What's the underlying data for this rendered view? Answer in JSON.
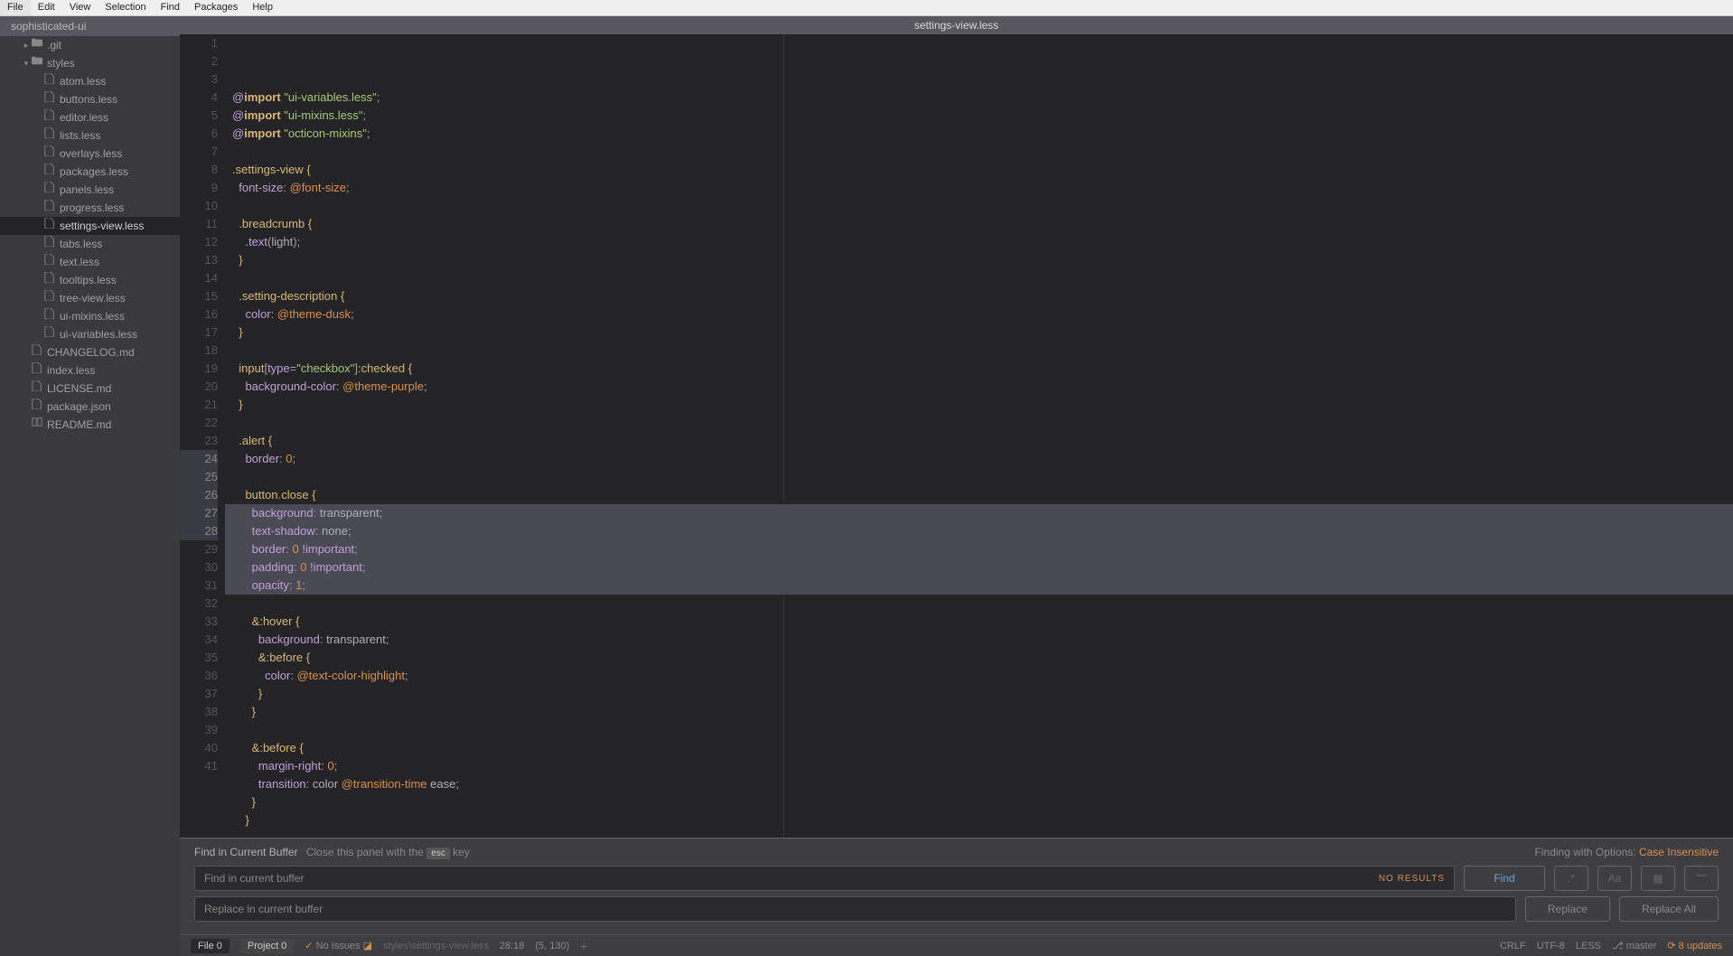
{
  "menubar": [
    "File",
    "Edit",
    "View",
    "Selection",
    "Find",
    "Packages",
    "Help"
  ],
  "project": {
    "title": "sophisticated-ui"
  },
  "tree": {
    "folders": [
      {
        "label": ".git",
        "chev": "▸",
        "depth": 1,
        "kind": "folder"
      },
      {
        "label": "styles",
        "chev": "▾",
        "depth": 1,
        "kind": "folder-open",
        "children": [
          {
            "label": "atom.less",
            "depth": 3
          },
          {
            "label": "buttons.less",
            "depth": 3
          },
          {
            "label": "editor.less",
            "depth": 3
          },
          {
            "label": "lists.less",
            "depth": 3
          },
          {
            "label": "overlays.less",
            "depth": 3
          },
          {
            "label": "packages.less",
            "depth": 3
          },
          {
            "label": "panels.less",
            "depth": 3
          },
          {
            "label": "progress.less",
            "depth": 3
          },
          {
            "label": "settings-view.less",
            "depth": 3,
            "selected": true
          },
          {
            "label": "tabs.less",
            "depth": 3
          },
          {
            "label": "text.less",
            "depth": 3
          },
          {
            "label": "tooltips.less",
            "depth": 3
          },
          {
            "label": "tree-view.less",
            "depth": 3
          },
          {
            "label": "ui-mixins.less",
            "depth": 3
          },
          {
            "label": "ui-variables.less",
            "depth": 3
          }
        ]
      }
    ],
    "root_files": [
      {
        "label": "CHANGELOG.md",
        "icon": "file"
      },
      {
        "label": "index.less",
        "icon": "file"
      },
      {
        "label": "LICENSE.md",
        "icon": "file"
      },
      {
        "label": "package.json",
        "icon": "file"
      },
      {
        "label": "README.md",
        "icon": "book"
      }
    ]
  },
  "tab": {
    "title": "settings-view.less"
  },
  "code": {
    "lines": [
      {
        "n": 1,
        "html": "<span class='tok-at'>@</span><span class='tok-keyword'>import</span> <span class='tok-string'>\"ui-variables.less\"</span><span class='tok-punc'>;</span>"
      },
      {
        "n": 2,
        "html": "<span class='tok-at'>@</span><span class='tok-keyword'>import</span> <span class='tok-string'>\"ui-mixins.less\"</span><span class='tok-punc'>;</span>"
      },
      {
        "n": 3,
        "html": "<span class='tok-at'>@</span><span class='tok-keyword'>import</span> <span class='tok-string'>\"octicon-mixins\"</span><span class='tok-punc'>;</span>"
      },
      {
        "n": 4,
        "html": ""
      },
      {
        "n": 5,
        "html": "<span class='tok-class'>.settings-view</span> <span class='tok-brace'>{</span>"
      },
      {
        "n": 6,
        "html": "  <span class='tok-prop'>font-size</span><span class='tok-punc'>:</span> <span class='tok-var'>@font-size</span><span class='tok-punc'>;</span>"
      },
      {
        "n": 7,
        "html": ""
      },
      {
        "n": 8,
        "html": "  <span class='tok-class'>.breadcrumb</span> <span class='tok-brace'>{</span>"
      },
      {
        "n": 9,
        "html": "    <span class='tok-at'>.text</span><span class='tok-punc'>(</span>light<span class='tok-punc'>);</span>"
      },
      {
        "n": 10,
        "html": "  <span class='tok-brace'>}</span>"
      },
      {
        "n": 11,
        "html": ""
      },
      {
        "n": 12,
        "html": "  <span class='tok-class'>.setting-description</span> <span class='tok-brace'>{</span>"
      },
      {
        "n": 13,
        "html": "    <span class='tok-prop'>color</span><span class='tok-punc'>:</span> <span class='tok-var'>@theme-dusk</span><span class='tok-punc'>;</span>"
      },
      {
        "n": 14,
        "html": "  <span class='tok-brace'>}</span>"
      },
      {
        "n": 15,
        "html": ""
      },
      {
        "n": 16,
        "html": "  <span class='tok-class'>input</span><span class='tok-punc'>[</span><span class='tok-prop'>type</span><span class='tok-punc'>=</span><span class='tok-string'>\"checkbox\"</span><span class='tok-punc'>]</span><span class='tok-class'>:checked</span> <span class='tok-brace'>{</span>"
      },
      {
        "n": 17,
        "html": "    <span class='tok-prop'>background-color</span><span class='tok-punc'>:</span> <span class='tok-var'>@theme-purple</span><span class='tok-punc'>;</span>"
      },
      {
        "n": 18,
        "html": "  <span class='tok-brace'>}</span>"
      },
      {
        "n": 19,
        "html": ""
      },
      {
        "n": 20,
        "html": "  <span class='tok-class'>.alert</span> <span class='tok-brace'>{</span>"
      },
      {
        "n": 21,
        "html": "    <span class='tok-prop'>border</span><span class='tok-punc'>:</span> <span class='tok-num'>0</span><span class='tok-punc'>;</span>"
      },
      {
        "n": 22,
        "html": ""
      },
      {
        "n": 23,
        "html": "    <span class='tok-class'>button</span><span class='tok-punc'>.</span><span class='tok-class'>close</span> <span class='tok-brace'>{</span>"
      },
      {
        "n": 24,
        "html": "      <span class='tok-prop'>background</span><span class='tok-punc'>:</span> transparent<span class='tok-punc'>;</span>",
        "sel": true
      },
      {
        "n": 25,
        "html": "      <span class='tok-prop'>text-shadow</span><span class='tok-punc'>:</span> none<span class='tok-punc'>;</span>",
        "sel": true
      },
      {
        "n": 26,
        "html": "      <span class='tok-prop'>border</span><span class='tok-punc'>:</span> <span class='tok-num'>0</span> <span class='tok-important'>!important</span><span class='tok-punc'>;</span>",
        "sel": true
      },
      {
        "n": 27,
        "html": "      <span class='tok-prop'>padding</span><span class='tok-punc'>:</span> <span class='tok-num'>0</span> <span class='tok-important'>!important</span><span class='tok-punc'>;</span>",
        "sel": true
      },
      {
        "n": 28,
        "html": "      <span class='tok-prop'>opacity</span><span class='tok-punc'>:</span> <span class='tok-num'>1</span><span class='tok-punc'>;</span>",
        "sel": true
      },
      {
        "n": 29,
        "html": ""
      },
      {
        "n": 30,
        "html": "      <span class='tok-class'>&amp;:hover</span> <span class='tok-brace'>{</span>"
      },
      {
        "n": 31,
        "html": "        <span class='tok-prop'>background</span><span class='tok-punc'>:</span> transparent<span class='tok-punc'>;</span>"
      },
      {
        "n": 32,
        "html": "        <span class='tok-class'>&amp;:before</span> <span class='tok-brace'>{</span>"
      },
      {
        "n": 33,
        "html": "          <span class='tok-prop'>color</span><span class='tok-punc'>:</span> <span class='tok-var'>@text-color-highlight</span><span class='tok-punc'>;</span>"
      },
      {
        "n": 34,
        "html": "        <span class='tok-brace'>}</span>"
      },
      {
        "n": 35,
        "html": "      <span class='tok-brace'>}</span>"
      },
      {
        "n": 36,
        "html": ""
      },
      {
        "n": 37,
        "html": "      <span class='tok-class'>&amp;:before</span> <span class='tok-brace'>{</span>"
      },
      {
        "n": 38,
        "html": "        <span class='tok-prop'>margin-right</span><span class='tok-punc'>:</span> <span class='tok-num'>0</span><span class='tok-punc'>;</span>"
      },
      {
        "n": 39,
        "html": "        <span class='tok-prop'>transition</span><span class='tok-punc'>:</span> color <span class='tok-var'>@transition-time</span> ease<span class='tok-punc'>;</span>"
      },
      {
        "n": 40,
        "html": "      <span class='tok-brace'>}</span>"
      },
      {
        "n": 41,
        "html": "    <span class='tok-brace'>}</span>"
      }
    ]
  },
  "find": {
    "title": "Find in Current Buffer",
    "hint_pre": "Close this panel with the",
    "hint_key": "esc",
    "hint_post": "key",
    "options_label": "Finding with Options:",
    "options_value": "Case Insensitive",
    "find_placeholder": "Find in current buffer",
    "no_results": "NO RESULTS",
    "find_btn": "Find",
    "replace_placeholder": "Replace in current buffer",
    "replace_btn": "Replace",
    "replace_all_btn": "Replace All"
  },
  "status": {
    "file_label": "File",
    "file_count": "0",
    "project_label": "Project",
    "project_count": "0",
    "issues": "No Issues",
    "path": "styles\\settings-view.less",
    "cursor1": "28:18",
    "cursor2": "(5, 130)",
    "encoding_eol": "CRLF",
    "encoding": "UTF-8",
    "grammar": "LESS",
    "branch": "master",
    "updates": "8 updates"
  }
}
